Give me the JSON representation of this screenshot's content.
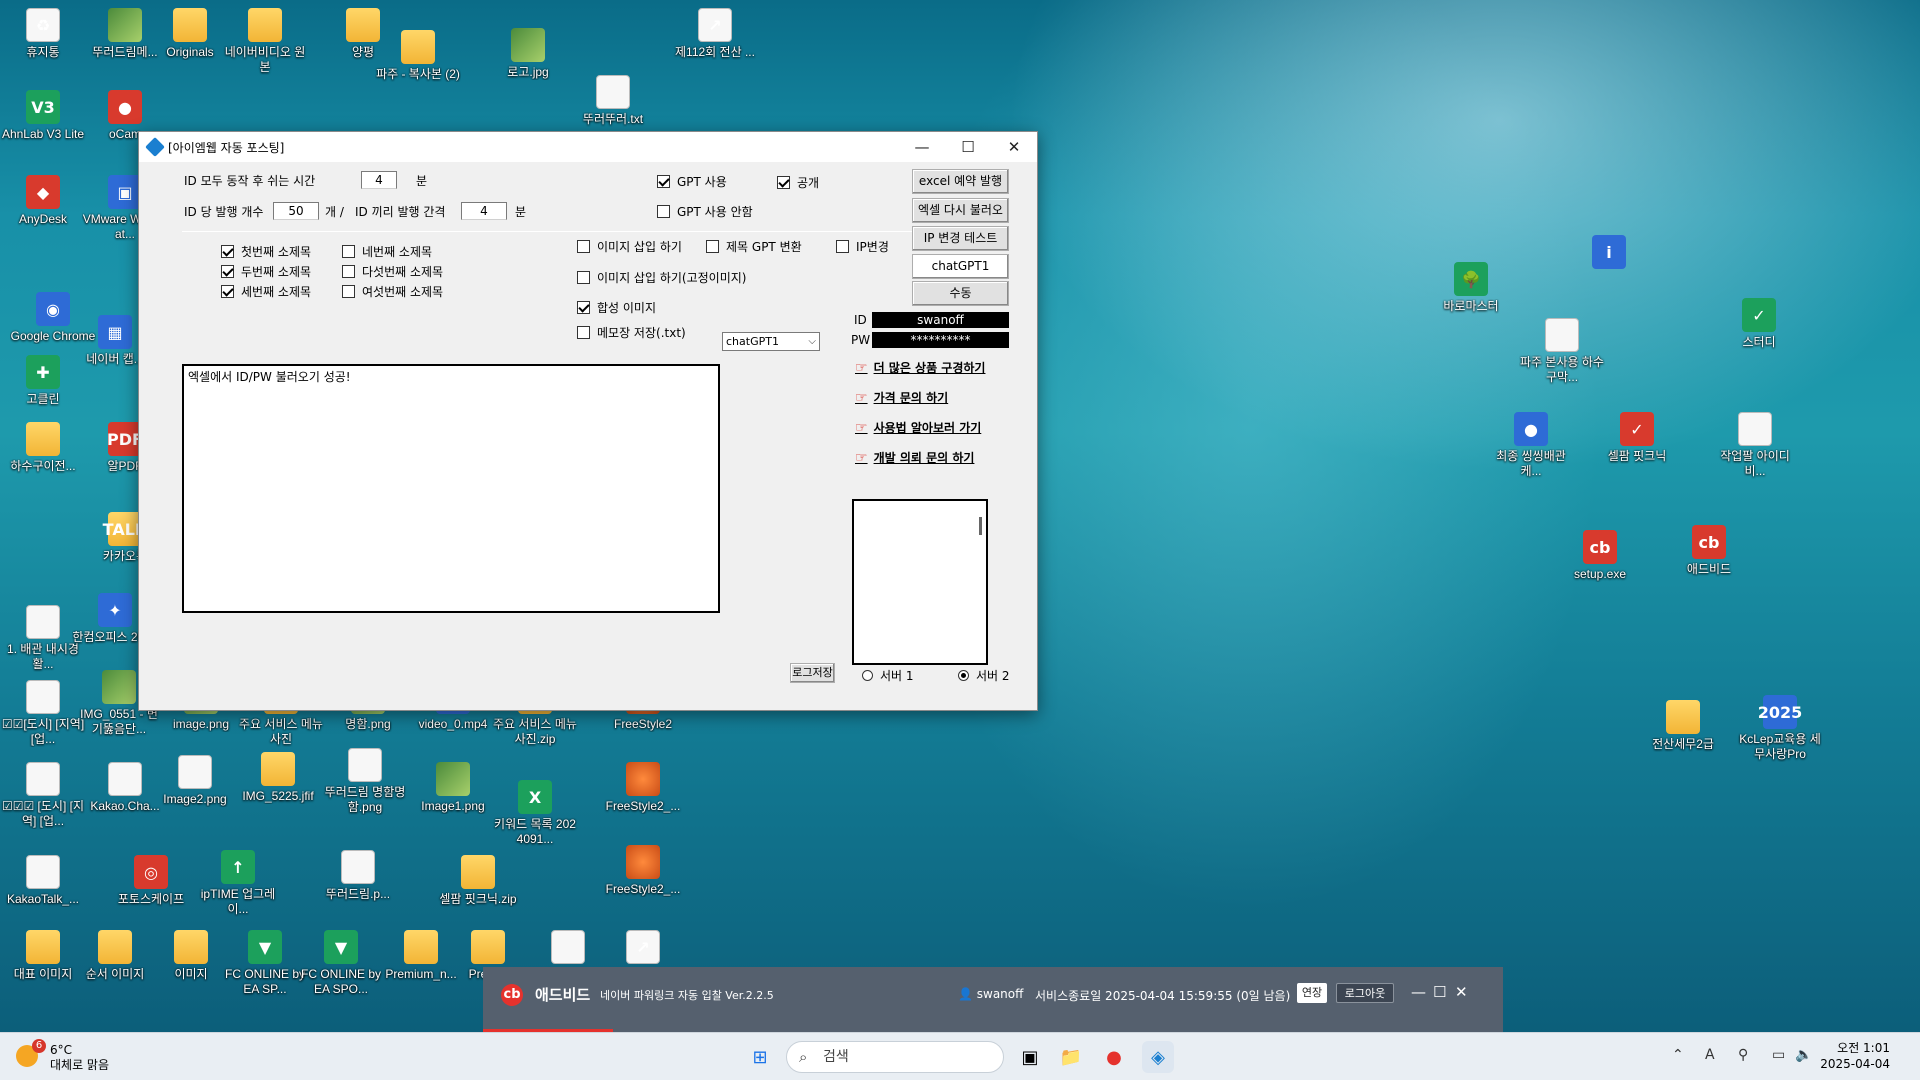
{
  "desktop": {
    "icons": [
      {
        "name": "recycle-bin",
        "label": "휴지통",
        "glyph": "♻",
        "kind": "file"
      },
      {
        "name": "desktop-icon",
        "label": "뚜러드림메...",
        "glyph": "",
        "kind": "img"
      },
      {
        "name": "desktop-icon",
        "label": "Originals",
        "glyph": "",
        "kind": "folder"
      },
      {
        "name": "desktop-icon",
        "label": "네이버비디오 원 본",
        "glyph": "",
        "kind": "folder"
      },
      {
        "name": "desktop-icon",
        "label": "양평",
        "glyph": "",
        "kind": "folder"
      },
      {
        "name": "desktop-icon",
        "label": "파주 - 복사본 (2)",
        "glyph": "",
        "kind": "folder"
      },
      {
        "name": "desktop-icon",
        "label": "로고.jpg",
        "glyph": "",
        "kind": "img"
      },
      {
        "name": "desktop-icon",
        "label": "제112회 전산 ...",
        "glyph": "↗",
        "kind": "file"
      },
      {
        "name": "desktop-icon",
        "label": "뚜러뚜러.txt",
        "glyph": "",
        "kind": "file"
      },
      {
        "name": "desktop-icon",
        "label": "AhnLab V3 Lite",
        "glyph": "V3",
        "kind": "green"
      },
      {
        "name": "desktop-icon",
        "label": "oCam",
        "glyph": "●",
        "kind": "red"
      },
      {
        "name": "desktop-icon",
        "label": "AnyDesk",
        "glyph": "◆",
        "kind": "red"
      },
      {
        "name": "desktop-icon",
        "label": "VMware Workstat...",
        "glyph": "▣",
        "kind": "app"
      },
      {
        "name": "desktop-icon",
        "label": "Google Chrome",
        "glyph": "◉",
        "kind": "app"
      },
      {
        "name": "desktop-icon",
        "label": "네이버 캡...",
        "glyph": "▦",
        "kind": "app"
      },
      {
        "name": "desktop-icon",
        "label": "고클린",
        "glyph": "✚",
        "kind": "green"
      },
      {
        "name": "desktop-icon",
        "label": "하수구이전...",
        "glyph": "",
        "kind": "folder"
      },
      {
        "name": "desktop-icon",
        "label": "알PDF",
        "glyph": "PDF",
        "kind": "red"
      },
      {
        "name": "desktop-icon",
        "label": "카카오톡",
        "glyph": "TALK",
        "kind": "folder"
      },
      {
        "name": "desktop-icon",
        "label": "1. 배관 내시경 활...",
        "glyph": "",
        "kind": "file"
      },
      {
        "name": "desktop-icon",
        "label": "한컴오피스 2020",
        "glyph": "✦",
        "kind": "app"
      },
      {
        "name": "desktop-icon",
        "label": "☑☑[도시] [지역] [업...",
        "glyph": "",
        "kind": "file"
      },
      {
        "name": "desktop-icon",
        "label": "IMG_0551 - 변기뚫음단...",
        "glyph": "",
        "kind": "img"
      },
      {
        "name": "desktop-icon",
        "label": "image.png",
        "glyph": "",
        "kind": "img"
      },
      {
        "name": "desktop-icon",
        "label": "주요 서비스 메뉴 사진",
        "glyph": "",
        "kind": "folder"
      },
      {
        "name": "desktop-icon",
        "label": "명함.png",
        "glyph": "",
        "kind": "img"
      },
      {
        "name": "desktop-icon",
        "label": "video_0.mp4",
        "glyph": "▶",
        "kind": "app"
      },
      {
        "name": "desktop-icon",
        "label": "주요 서비스 메뉴 사진.zip",
        "glyph": "",
        "kind": "folder"
      },
      {
        "name": "desktop-icon",
        "label": "FreeStyle2",
        "glyph": "",
        "kind": "ball"
      },
      {
        "name": "desktop-icon",
        "label": "☑☑☑ [도시] [지역] [업...",
        "glyph": "",
        "kind": "file"
      },
      {
        "name": "desktop-icon",
        "label": "Kakao.Cha...",
        "glyph": "",
        "kind": "file"
      },
      {
        "name": "desktop-icon",
        "label": "Image2.png",
        "glyph": "",
        "kind": "file"
      },
      {
        "name": "desktop-icon",
        "label": "IMG_5225.jfif",
        "glyph": "",
        "kind": "folder"
      },
      {
        "name": "desktop-icon",
        "label": "뚜러드림 명함명함.png",
        "glyph": "",
        "kind": "file"
      },
      {
        "name": "desktop-icon",
        "label": "Image1.png",
        "glyph": "",
        "kind": "img"
      },
      {
        "name": "desktop-icon",
        "label": "키워드 목록 2024091...",
        "glyph": "X",
        "kind": "green"
      },
      {
        "name": "desktop-icon",
        "label": "FreeStyle2_...",
        "glyph": "",
        "kind": "ball"
      },
      {
        "name": "desktop-icon",
        "label": "KakaoTalk_...",
        "glyph": "",
        "kind": "file"
      },
      {
        "name": "desktop-icon",
        "label": "포토스케이프",
        "glyph": "◎",
        "kind": "red"
      },
      {
        "name": "desktop-icon",
        "label": "ipTIME 업그레이...",
        "glyph": "↑",
        "kind": "green"
      },
      {
        "name": "desktop-icon",
        "label": "뚜러드림.p...",
        "glyph": "",
        "kind": "file"
      },
      {
        "name": "desktop-icon",
        "label": "셀팜 핏크닉.zip",
        "glyph": "",
        "kind": "folder"
      },
      {
        "name": "desktop-icon",
        "label": "FreeStyle2_...",
        "glyph": "",
        "kind": "ball"
      },
      {
        "name": "desktop-icon",
        "label": "대표 이미지",
        "glyph": "",
        "kind": "folder"
      },
      {
        "name": "desktop-icon",
        "label": "순서 이미지",
        "glyph": "",
        "kind": "folder"
      },
      {
        "name": "desktop-icon",
        "label": "이미지",
        "glyph": "",
        "kind": "folder"
      },
      {
        "name": "desktop-icon",
        "label": "FC ONLINE by EA SP...",
        "glyph": "▼",
        "kind": "green"
      },
      {
        "name": "desktop-icon",
        "label": "FC ONLINE by EA SPO...",
        "glyph": "▼",
        "kind": "green"
      },
      {
        "name": "desktop-icon",
        "label": "Premium_n...",
        "glyph": "",
        "kind": "folder"
      },
      {
        "name": "desktop-icon",
        "label": "Prem...",
        "glyph": "",
        "kind": "folder"
      },
      {
        "name": "desktop-icon",
        "label": "",
        "glyph": "",
        "kind": "file"
      },
      {
        "name": "desktop-icon",
        "label": "",
        "glyph": "↗",
        "kind": "file"
      },
      {
        "name": "desktop-icon",
        "label": "바로마스터",
        "glyph": "🌳",
        "kind": "green"
      },
      {
        "name": "desktop-icon",
        "label": "",
        "glyph": "i",
        "kind": "app"
      },
      {
        "name": "desktop-icon",
        "label": "파주 본사용 하수구막...",
        "glyph": "",
        "kind": "file"
      },
      {
        "name": "desktop-icon",
        "label": "스터디",
        "glyph": "✓",
        "kind": "green"
      },
      {
        "name": "desktop-icon",
        "label": "최종 씽씽배관케...",
        "glyph": "●",
        "kind": "app"
      },
      {
        "name": "desktop-icon",
        "label": "셀팜 핏크닉",
        "glyph": "✓",
        "kind": "red"
      },
      {
        "name": "desktop-icon",
        "label": "작업팔 아이디 비...",
        "glyph": "",
        "kind": "file"
      },
      {
        "name": "desktop-icon",
        "label": "setup.exe",
        "glyph": "cb",
        "kind": "red"
      },
      {
        "name": "desktop-icon",
        "label": "애드비드",
        "glyph": "cb",
        "kind": "red"
      },
      {
        "name": "desktop-icon",
        "label": "전산세무2급",
        "glyph": "",
        "kind": "folder"
      },
      {
        "name": "desktop-icon",
        "label": "KcLep교육용 세무사랑Pro",
        "glyph": "2025",
        "kind": "app"
      }
    ]
  },
  "app": {
    "title": "[아이엠웹 자동 포스팅]",
    "rest_label": "ID 모두 동작 후 쉬는 시간",
    "rest_value": "4",
    "rest_unit": "분",
    "per_id_label": "ID 당 발행 개수",
    "per_id_value": "50",
    "per_id_unit": "개 /",
    "interval_label": "ID 끼리 발행 간격",
    "interval_value": "4",
    "interval_unit": "분",
    "gpt_use": "GPT 사용",
    "gpt_no": "GPT 사용 안함",
    "public": "공개",
    "subtitles": [
      "첫번째 소제목",
      "두번째 소제목",
      "세번째 소제목",
      "네번째 소제목",
      "다섯번째 소제목",
      "여섯번째 소제목"
    ],
    "image_insert": "이미지 삽입 하기",
    "title_gpt": "제목 GPT 변환",
    "ip_change": "IP변경",
    "image_insert_fixed": "이미지 삽입 하기(고정이미지)",
    "synth_image": "합성 이미지",
    "memo_save": "메모장 저장(.txt)",
    "gpt_select": "chatGPT1",
    "btn_excel_reserve": "excel 예약 발행",
    "btn_excel_reload": "엑셀 다시 불러오기",
    "btn_ip_test": "IP 변경 테스트",
    "btn_chatgpt": "chatGPT1",
    "btn_manual": "수동",
    "id_label": "ID",
    "id_value": "swanoff",
    "pw_label": "PW",
    "pw_value": "**********",
    "links": [
      "더 많은 상품 구경하기",
      "가격 문의 하기",
      "사용법 알아보러 가기",
      "개발 의뢰 문의 하기"
    ],
    "log_text": "엑셀에서 ID/PW 불러오기 성공!",
    "log_save": "로그저장",
    "server1": "서버 1",
    "server2": "서버 2"
  },
  "adbid": {
    "logo": "cb",
    "brand": "애드비드",
    "subtitle": "네이버 파워링크 자동 입찰 Ver.2.2.5",
    "user": "swanoff",
    "expiry": "서비스종료일 2025-04-04 15:59:55 (0일 남음)",
    "extend": "연장",
    "logout": "로그아웃"
  },
  "taskbar": {
    "temp": "6°C",
    "weather": "대체로 맑음",
    "weather_badge": "6",
    "search_placeholder": "검색",
    "time": "오전 1:01",
    "date": "2025-04-04"
  }
}
